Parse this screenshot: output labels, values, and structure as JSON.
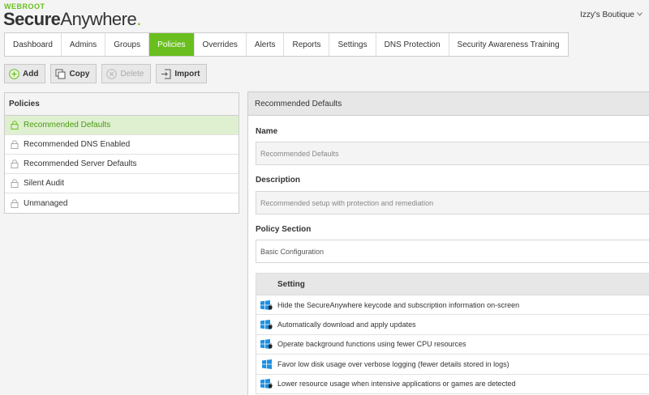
{
  "logo": {
    "top": "WEBROOT",
    "bold": "Secure",
    "light": "Anywhere",
    "trademark": "."
  },
  "account": {
    "name": "Izzy's Boutique"
  },
  "tabs": [
    {
      "label": "Dashboard"
    },
    {
      "label": "Admins"
    },
    {
      "label": "Groups"
    },
    {
      "label": "Policies",
      "active": true
    },
    {
      "label": "Overrides"
    },
    {
      "label": "Alerts"
    },
    {
      "label": "Reports"
    },
    {
      "label": "Settings"
    },
    {
      "label": "DNS Protection"
    },
    {
      "label": "Security Awareness Training"
    }
  ],
  "toolbar": {
    "add": "Add",
    "copy": "Copy",
    "delete": "Delete",
    "import": "Import"
  },
  "policies": {
    "header": "Policies",
    "items": [
      {
        "label": "Recommended Defaults",
        "active": true
      },
      {
        "label": "Recommended DNS Enabled"
      },
      {
        "label": "Recommended Server Defaults"
      },
      {
        "label": "Silent Audit"
      },
      {
        "label": "Unmanaged"
      }
    ]
  },
  "detail": {
    "header": "Recommended Defaults",
    "name_label": "Name",
    "name_value": "Recommended Defaults",
    "description_label": "Description",
    "description_value": "Recommended setup with protection and remediation",
    "section_label": "Policy Section",
    "section_value": "Basic Configuration",
    "setting_header": "Setting",
    "settings": [
      {
        "label": "Hide the SecureAnywhere keycode and subscription information on-screen",
        "os": "windows-mac"
      },
      {
        "label": "Automatically download and apply updates",
        "os": "windows-mac"
      },
      {
        "label": "Operate background functions using fewer CPU resources",
        "os": "windows-mac"
      },
      {
        "label": "Favor low disk usage over verbose logging (fewer details stored in logs)",
        "os": "windows"
      },
      {
        "label": "Lower resource usage when intensive applications or games are detected",
        "os": "windows-mac"
      }
    ]
  },
  "colors": {
    "accent": "#6abf1f",
    "active_row_bg": "#dff0d0",
    "windows_blue": "#1e90e0"
  }
}
